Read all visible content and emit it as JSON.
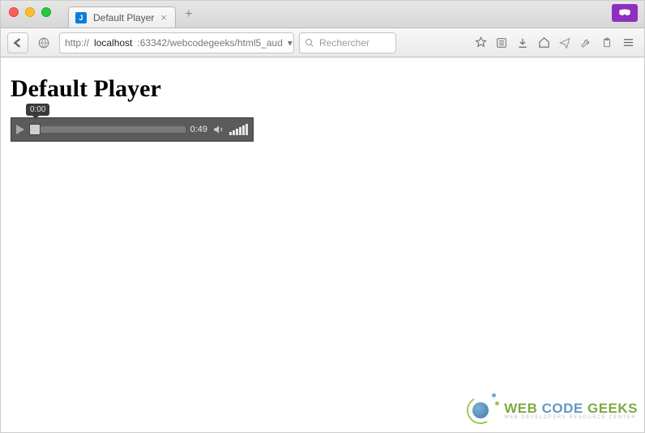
{
  "browser": {
    "tab": {
      "title": "Default Player",
      "favicon_letter": "J"
    },
    "url_prefix": "http://",
    "url_host": "localhost",
    "url_rest": ":63342/webcodegeeks/html5_aud",
    "search_placeholder": "Rechercher"
  },
  "page": {
    "heading": "Default Player"
  },
  "audio": {
    "current_time": "0:00",
    "duration": "0:49"
  },
  "watermark": {
    "word1": "WEB ",
    "word2": "CODE ",
    "word3": "GEEKS",
    "tagline": "WEB DEVELOPERS RESOURCE CENTER"
  }
}
